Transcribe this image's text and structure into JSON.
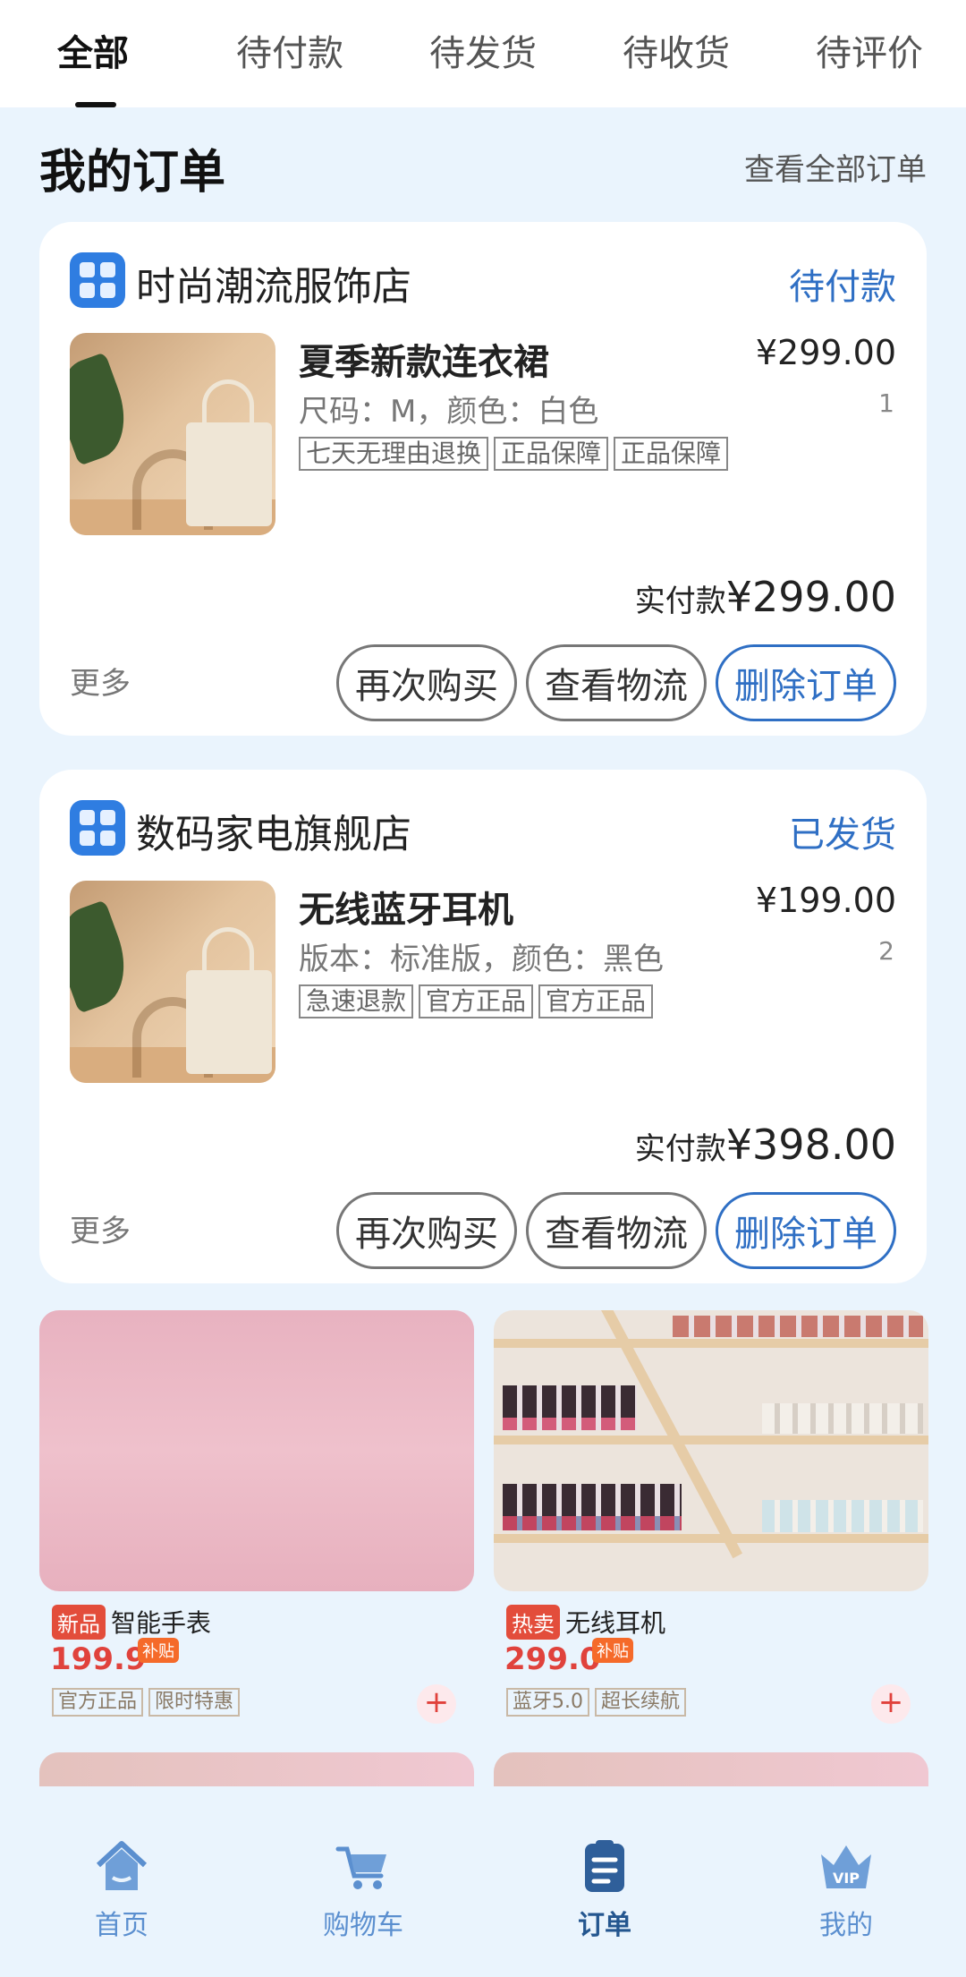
{
  "tabs": [
    "全部",
    "待付款",
    "待发货",
    "待收货",
    "待评价"
  ],
  "section": {
    "title": "我的订单",
    "link": "查看全部订单"
  },
  "orders": [
    {
      "shop": "时尚潮流服饰店",
      "status": "待付款",
      "product": "夏季新款连衣裙",
      "price": "¥299.00",
      "spec": "尺码：M，颜色：白色",
      "qty": "1",
      "tags": [
        "七天无理由退换",
        "正品保障",
        "正品保障"
      ],
      "paid_label": "实付款",
      "paid_amount": "¥299.00",
      "more": "更多",
      "buttons": [
        "再次购买",
        "查看物流",
        "删除订单"
      ]
    },
    {
      "shop": "数码家电旗舰店",
      "status": "已发货",
      "product": "无线蓝牙耳机",
      "price": "¥199.00",
      "spec": "版本：标准版，颜色：黑色",
      "qty": "2",
      "tags": [
        "急速退款",
        "官方正品",
        "官方正品"
      ],
      "paid_label": "实付款",
      "paid_amount": "¥398.00",
      "more": "更多",
      "buttons": [
        "再次购买",
        "查看物流",
        "删除订单"
      ]
    }
  ],
  "recommendations": [
    {
      "badge": "新品",
      "title": "智能手表",
      "price": "199.9",
      "subsidy": "补贴",
      "tags": [
        "官方正品",
        "限时特惠"
      ]
    },
    {
      "badge": "热卖",
      "title": "无线耳机",
      "price": "299.0",
      "subsidy": "补贴",
      "tags": [
        "蓝牙5.0",
        "超长续航"
      ]
    }
  ],
  "nav": [
    "首页",
    "购物车",
    "订单",
    "我的"
  ],
  "nav_icons": [
    "home-icon",
    "cart-icon",
    "orders-icon",
    "vip-crown-icon"
  ],
  "vip_text": "VIP",
  "colors": {
    "accent": "#2f6fc4",
    "price_red": "#e0423c",
    "page_bg": "#eaf4fd"
  }
}
